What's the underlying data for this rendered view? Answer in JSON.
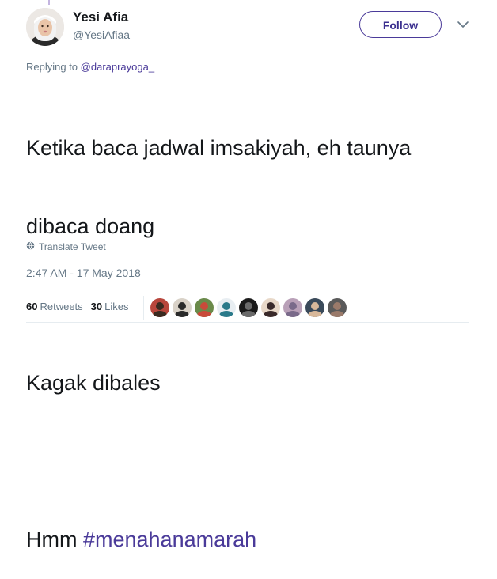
{
  "user": {
    "display_name": "Yesi Afia",
    "handle": "@YesiAfiaa"
  },
  "follow_button": {
    "label": "Follow"
  },
  "menu": {
    "icon": "chevron-down-icon"
  },
  "reply": {
    "prefix": "Replying to ",
    "to_handle": "@daraprayoga_"
  },
  "tweet": {
    "line1": "Ketika baca jadwal imsakiyah, eh taunya",
    "line2": "dibaca doang",
    "line3": "Kagak dibales",
    "line4_prefix": "Hmm ",
    "hashtag": "#menahanamarah"
  },
  "translate": {
    "label": "Translate Tweet",
    "icon": "globe-icon"
  },
  "timestamp": "2:47 AM - 17 May 2018",
  "stats": {
    "retweets_count": "60",
    "retweets_label": "Retweets",
    "likes_count": "30",
    "likes_label": "Likes"
  },
  "colors": {
    "accent": "#4a3a99",
    "text": "#14171a",
    "muted": "#657786",
    "divider": "#e6ecf0"
  },
  "liker_avatars": [
    {
      "bg": "#b8463c",
      "fg": "#3a2a20"
    },
    {
      "bg": "#d9d2c8",
      "fg": "#2a2a2a"
    },
    {
      "bg": "#6a8a4a",
      "fg": "#c94a3a"
    },
    {
      "bg": "#e8eef2",
      "fg": "#2a7a8a"
    },
    {
      "bg": "#1a1a1a",
      "fg": "#6a6a6a"
    },
    {
      "bg": "#e8d8c8",
      "fg": "#3a2a2a"
    },
    {
      "bg": "#b9a0b8",
      "fg": "#7a6a8a"
    },
    {
      "bg": "#3a4a5a",
      "fg": "#d8b89a"
    },
    {
      "bg": "#5a5a5a",
      "fg": "#9a7a6a"
    }
  ]
}
